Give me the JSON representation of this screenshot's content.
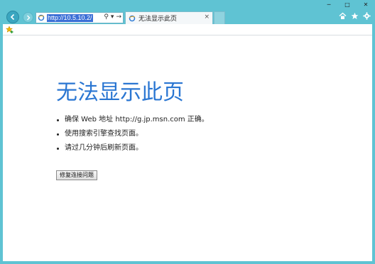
{
  "browser": {
    "address": {
      "url": "http://10.5.10.2/"
    },
    "tab": {
      "title": "无法显示此页",
      "close_glyph": "×"
    },
    "window_controls": [
      "─",
      "□",
      "✕"
    ],
    "address_tools": {
      "search_glyph": "⚲",
      "dropdown_glyph": "▾",
      "go_glyph": "→"
    }
  },
  "page": {
    "title": "无法显示此页",
    "bullets": [
      "确保 Web 地址 http://g.jp.msn.com 正确。",
      "使用搜索引擎查找页面。",
      "请过几分钟后刷新页面。"
    ],
    "fix_button_label": "修复连接问题"
  },
  "colors": {
    "frame": "#5fc3d3",
    "title_blue": "#2a76d2",
    "address_highlight": "#3b6fd6"
  }
}
